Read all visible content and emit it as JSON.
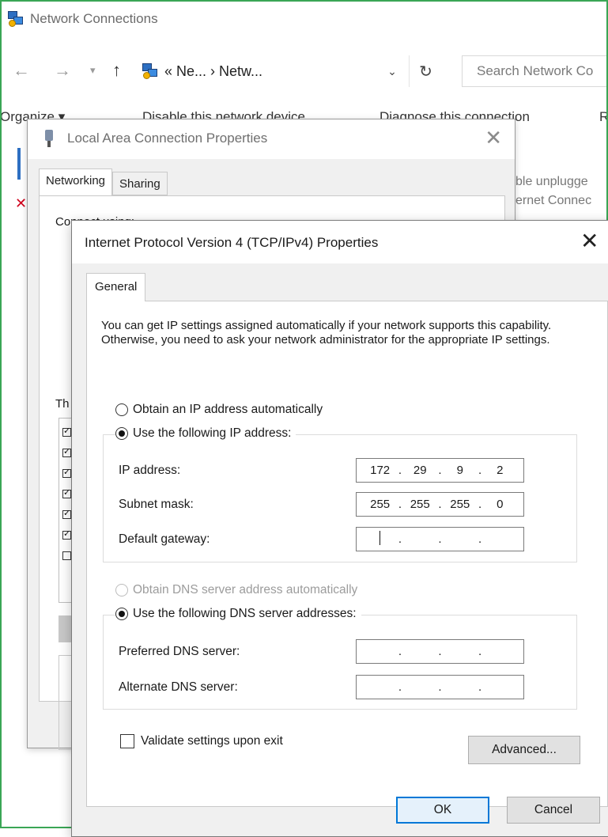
{
  "explorer": {
    "title": "Network Connections",
    "address_crumbs": "« Ne... › Netw...",
    "search_placeholder": "Search Network Co",
    "commands": [
      "Organize ▾",
      "Disable this network device",
      "Diagnose this connection",
      "R"
    ],
    "side_text": [
      "ble unplugge",
      "ernet Connec"
    ]
  },
  "lac_dialog": {
    "title": "Local Area Connection Properties",
    "tabs": [
      "Networking",
      "Sharing"
    ],
    "connect_label": "Connect using:",
    "list_label": "Th"
  },
  "ipv4_dialog": {
    "title": "Internet Protocol Version 4 (TCP/IPv4) Properties",
    "tab": "General",
    "description": "You can get IP settings assigned automatically if your network supports this capability. Otherwise, you need to ask your network administrator for the appropriate IP settings.",
    "ip_options": {
      "auto": "Obtain an IP address automatically",
      "manual": "Use the following IP address:"
    },
    "ip_fields": {
      "ip_label": "IP address:",
      "ip_value": [
        "172",
        "29",
        "9",
        "2"
      ],
      "subnet_label": "Subnet mask:",
      "subnet_value": [
        "255",
        "255",
        "255",
        "0"
      ],
      "gateway_label": "Default gateway:",
      "gateway_value": [
        "",
        "",
        "",
        ""
      ]
    },
    "dns_options": {
      "auto": "Obtain DNS server address automatically",
      "manual": "Use the following DNS server addresses:"
    },
    "dns_fields": {
      "preferred_label": "Preferred DNS server:",
      "preferred_value": [
        "",
        "",
        "",
        ""
      ],
      "alternate_label": "Alternate DNS server:",
      "alternate_value": [
        "",
        "",
        "",
        ""
      ]
    },
    "validate_label": "Validate settings upon exit",
    "advanced_button": "Advanced...",
    "ok_button": "OK",
    "cancel_button": "Cancel",
    "selected": {
      "ip_mode": "manual",
      "dns_mode": "manual",
      "validate_checked": false
    }
  }
}
